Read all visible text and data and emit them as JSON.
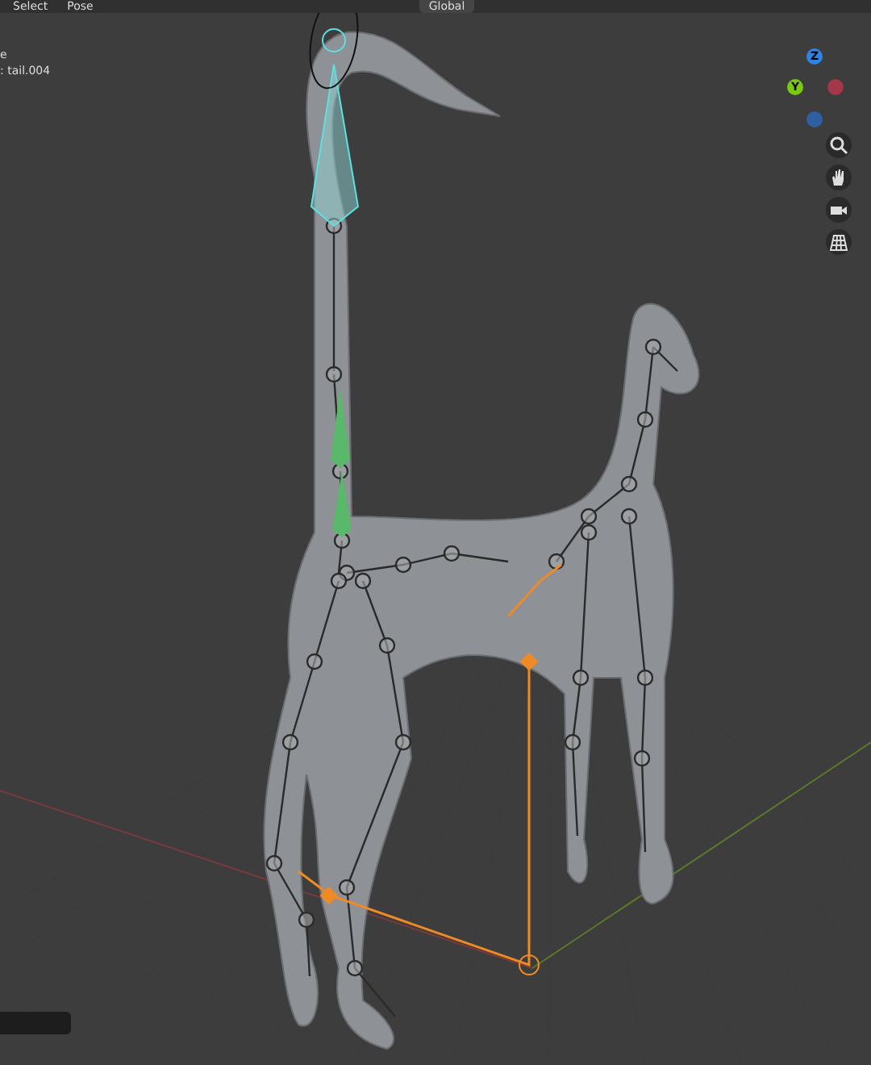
{
  "header": {
    "menus": [
      "Select",
      "Pose"
    ],
    "orientation": "Global"
  },
  "viewport_info": [
    "e",
    ": tail.004"
  ],
  "navigation_gizmo": {
    "axes": [
      {
        "label": "Z",
        "color": "#2f83e3"
      },
      {
        "label": "Y",
        "color": "#7bc814"
      }
    ]
  }
}
